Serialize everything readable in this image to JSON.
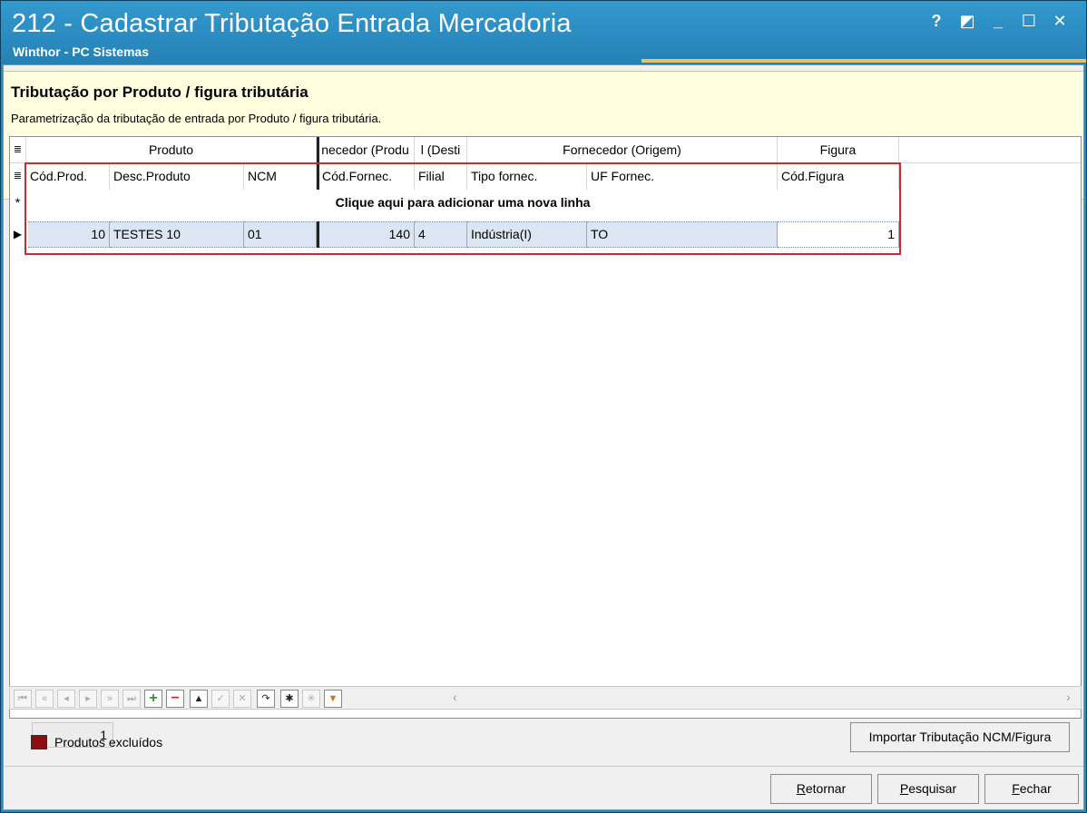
{
  "window": {
    "title": "212 - Cadastrar Tributação Entrada Mercadoria",
    "subtitle": "Winthor - PC Sistemas",
    "buttons": {
      "help": "?",
      "restore": "◩",
      "minimize": "_",
      "maximize": "☐",
      "close": "✕"
    }
  },
  "header": {
    "title": "Tributação por Produto / figura tributária",
    "description": "Parametrização da tributação de entrada por Produto / figura tributária."
  },
  "grid": {
    "bands": [
      "Produto",
      "necedor (Produ",
      "l (Desti",
      "Fornecedor (Origem)",
      "Figura"
    ],
    "columns": [
      "Cód.Prod.",
      "Desc.Produto",
      "NCM",
      "Cód.Fornec.",
      "Filial",
      "Tipo fornec.",
      "UF Fornec.",
      "Cód.Figura"
    ],
    "add_row_text": "Clique aqui para adicionar uma nova linha",
    "add_row_marker": "*",
    "rows": [
      {
        "cod_prod": "10",
        "desc_produto": "TESTES 10",
        "ncm": "01",
        "cod_fornec": "140",
        "filial": "4",
        "tipo_fornec": "Indústria(I)",
        "uf_fornec": "TO",
        "cod_figura": "1"
      }
    ],
    "footer_count": "1"
  },
  "legend": {
    "label": "Produtos excluídos",
    "color": "#8b0e0e"
  },
  "buttons": {
    "importar": "Importar Tributação NCM/Figura",
    "retornar_u": "R",
    "retornar_rest": "etornar",
    "pesquisar_u": "P",
    "pesquisar_rest": "esquisar",
    "fechar_u": "F",
    "fechar_rest": "echar"
  },
  "colors": {
    "titlebar": "#2a89b8",
    "header_bg": "#ffffe0",
    "highlight": "#cc2a30",
    "selected_row": "#dbe6f2"
  }
}
